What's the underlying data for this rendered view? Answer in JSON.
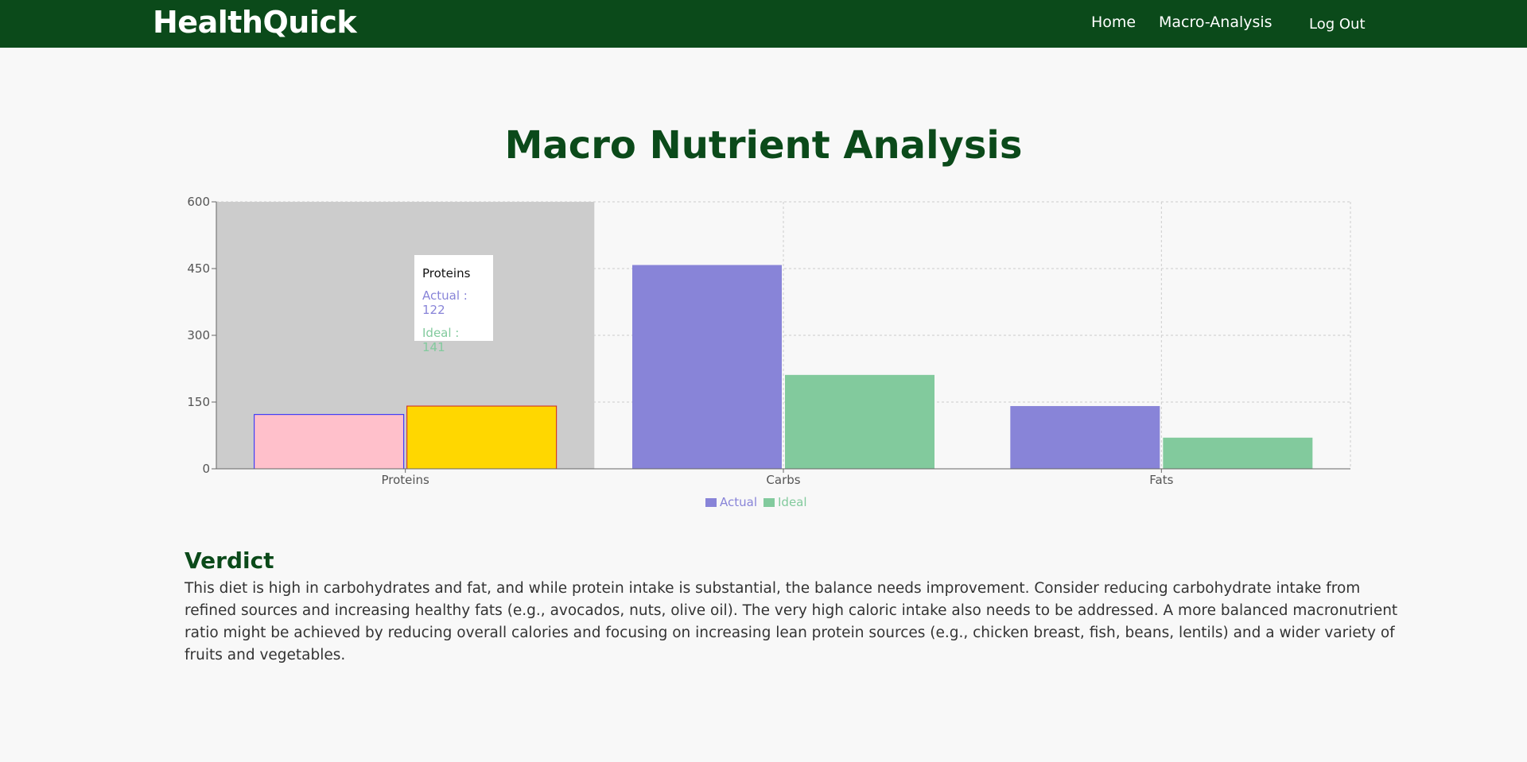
{
  "nav": {
    "brand": "HealthQuick",
    "links": [
      {
        "label": "Home"
      },
      {
        "label": "Macro-Analysis"
      },
      {
        "label": "Log Out"
      }
    ]
  },
  "page": {
    "title": "Macro Nutrient Analysis"
  },
  "colors": {
    "nav_bg": "#0b4a1a",
    "title": "#0b4a1a",
    "actual": "#8884d8",
    "ideal": "#82ca9d",
    "highlight_band": "#cccccc",
    "active_actual_fill": "#ffc0cb",
    "active_actual_stroke": "#2222ff",
    "active_ideal_fill": "#ffd700",
    "active_ideal_stroke": "#cc2222"
  },
  "chart_data": {
    "type": "bar",
    "categories": [
      "Proteins",
      "Carbs",
      "Fats"
    ],
    "series": [
      {
        "name": "Actual",
        "values": [
          122,
          458,
          141
        ]
      },
      {
        "name": "Ideal",
        "values": [
          141,
          211,
          70
        ]
      }
    ],
    "ylim": [
      0,
      600
    ],
    "yticks": [
      "0",
      "150",
      "300",
      "450",
      "600"
    ],
    "grid": true,
    "legend": "bottom-center",
    "active_category": "Proteins"
  },
  "tooltip": {
    "title": "Proteins",
    "actual_line": "Actual : 122",
    "ideal_line": "Ideal : 141"
  },
  "verdict": {
    "heading": "Verdict",
    "text": "This diet is high in carbohydrates and fat, and while protein intake is substantial, the balance needs improvement. Consider reducing carbohydrate intake from refined sources and increasing healthy fats (e.g., avocados, nuts, olive oil). The very high caloric intake also needs to be addressed. A more balanced macronutrient ratio might be achieved by reducing overall calories and focusing on increasing lean protein sources (e.g., chicken breast, fish, beans, lentils) and a wider variety of fruits and vegetables."
  }
}
